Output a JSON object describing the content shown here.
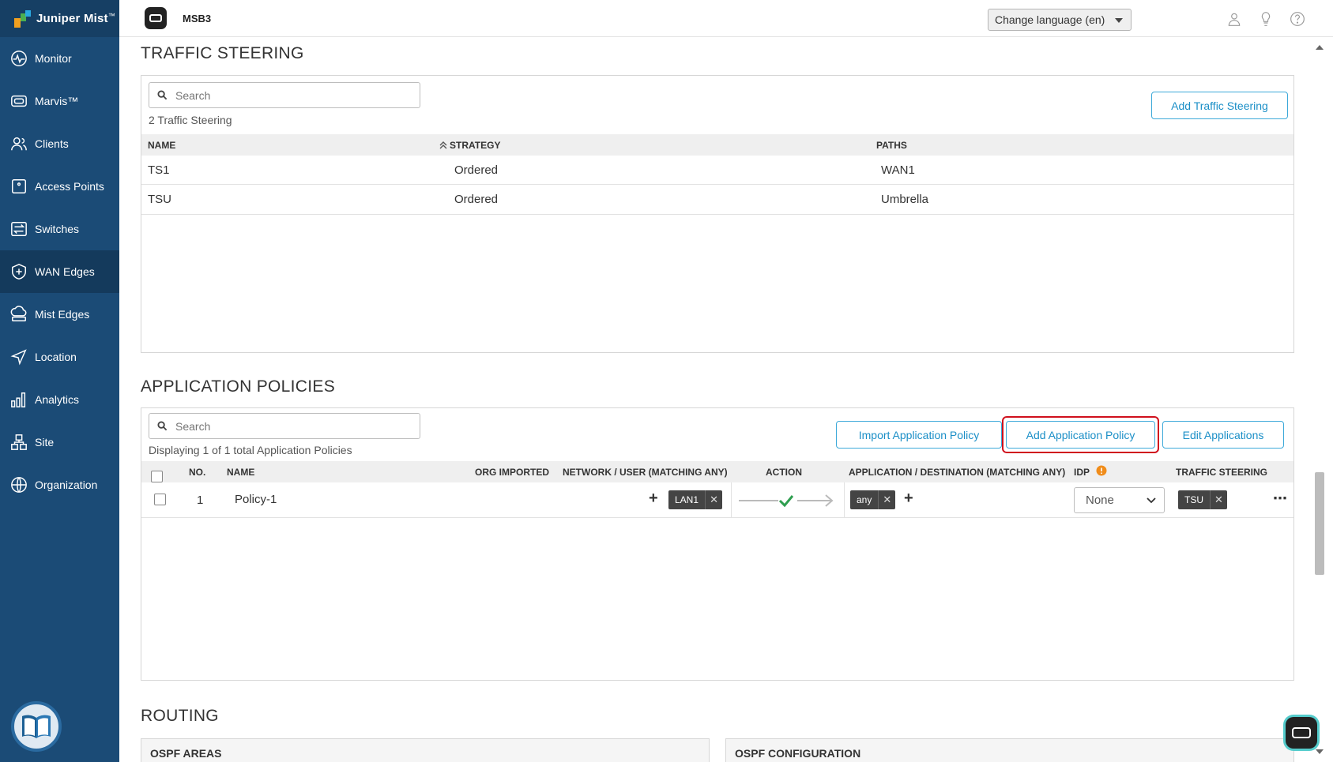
{
  "app": {
    "brand": "Juniper Mist",
    "trademark": "™",
    "site_name": "MSB3",
    "language_label": "Change language (en)"
  },
  "sidebar": {
    "items": [
      {
        "label": "Monitor",
        "icon": "monitor-icon"
      },
      {
        "label": "Marvis™",
        "icon": "marvis-icon"
      },
      {
        "label": "Clients",
        "icon": "clients-icon"
      },
      {
        "label": "Access Points",
        "icon": "access-points-icon"
      },
      {
        "label": "Switches",
        "icon": "switches-icon"
      },
      {
        "label": "WAN Edges",
        "icon": "wan-edges-icon",
        "active": true
      },
      {
        "label": "Mist Edges",
        "icon": "mist-edges-icon"
      },
      {
        "label": "Location",
        "icon": "location-icon"
      },
      {
        "label": "Analytics",
        "icon": "analytics-icon"
      },
      {
        "label": "Site",
        "icon": "site-icon"
      },
      {
        "label": "Organization",
        "icon": "organization-icon"
      }
    ]
  },
  "traffic_steering": {
    "title": "TRAFFIC STEERING",
    "search_placeholder": "Search",
    "count": "2 Traffic Steering",
    "add_button": "Add Traffic Steering",
    "columns": [
      "NAME",
      "STRATEGY",
      "PATHS"
    ],
    "rows": [
      {
        "name": "TS1",
        "strategy": "Ordered",
        "paths": "WAN1"
      },
      {
        "name": "TSU",
        "strategy": "Ordered",
        "paths": "Umbrella"
      }
    ]
  },
  "application_policies": {
    "title": "APPLICATION POLICIES",
    "search_placeholder": "Search",
    "count": "Displaying 1 of 1 total Application Policies",
    "import_button": "Import Application Policy",
    "add_button": "Add Application Policy",
    "edit_button": "Edit Applications",
    "columns": {
      "no": "NO.",
      "name": "NAME",
      "org_imported": "ORG IMPORTED",
      "network": "NETWORK / USER (MATCHING ANY)",
      "action": "ACTION",
      "application": "APPLICATION / DESTINATION (MATCHING ANY)",
      "idp": "IDP",
      "traffic_steering": "TRAFFIC STEERING"
    },
    "rows": [
      {
        "no": "1",
        "name": "Policy-1",
        "network_tag": "LAN1",
        "application_tag": "any",
        "idp": "None",
        "traffic_steering_tag": "TSU",
        "more": "⋯"
      }
    ]
  },
  "routing": {
    "title": "ROUTING",
    "ospf_areas": "OSPF AREAS",
    "ospf_configuration": "OSPF CONFIGURATION"
  },
  "glyphs": {
    "close": "✕",
    "plus": "+"
  },
  "colors": {
    "sidebar": "#1b4b76",
    "accent": "#1b8fc7",
    "highlight": "#d0101d",
    "allow": "#2e9e4f",
    "warning": "#f08c1a"
  }
}
